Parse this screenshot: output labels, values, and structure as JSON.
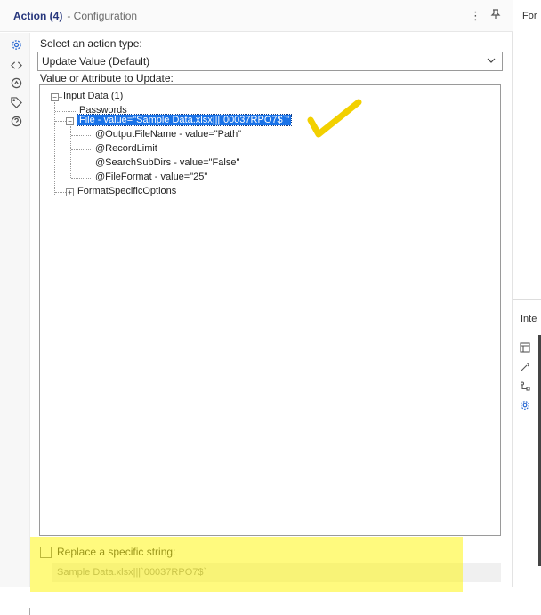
{
  "panel": {
    "title": "Action (4)",
    "subtitle": "- Configuration"
  },
  "form": {
    "action_type_label": "Select an action type:",
    "action_type_value": "Update Value (Default)",
    "value_label": "Value or Attribute to Update:"
  },
  "tree": {
    "root": "Input Data (1)",
    "passwords": "Passwords",
    "file": "File - value=\"Sample Data.xlsx|||`00037RPO7$`\"",
    "children": [
      "@OutputFileName - value=\"Path\"",
      "@RecordLimit",
      "@SearchSubDirs - value=\"False\"",
      "@FileFormat - value=\"25\""
    ],
    "format_options": "FormatSpecificOptions"
  },
  "replace": {
    "label": "Replace a specific string:",
    "value": "Sample Data.xlsx|||`00037RPO7$`"
  },
  "right_panel": {
    "title_top": "For",
    "title_mid": "Inte"
  },
  "colors": {
    "accent": "#2d6bd3",
    "selection": "#1a73e8",
    "highlight": "#fff514",
    "annotation": "#f2d000"
  }
}
